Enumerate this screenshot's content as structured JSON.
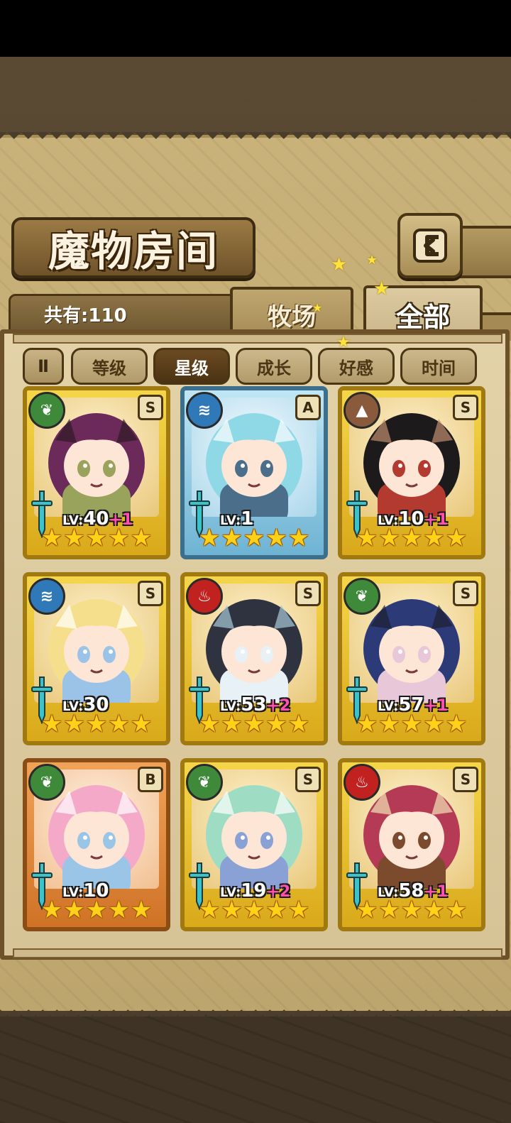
{
  "header": {
    "title": "魔物房间",
    "back_icon": "back-arrow-icon"
  },
  "tabs": {
    "count_label": "共有:110",
    "ranch_label": "牧场",
    "all_label": "全部"
  },
  "filters": {
    "pause_label": "Ⅱ",
    "items": [
      "等级",
      "星级",
      "成长",
      "好感",
      "时间"
    ],
    "active": "星级"
  },
  "monsters": [
    {
      "element": "grass",
      "rank": "S",
      "level": "40",
      "plus": "+1",
      "stars": 5,
      "palette": [
        "#6b2a5a",
        "#2d1a24",
        "#9aa35c"
      ]
    },
    {
      "element": "water",
      "rank": "A",
      "level": "1",
      "plus": "",
      "stars": 5,
      "palette": [
        "#8fd8e6",
        "#ffffff",
        "#4b6f8a"
      ]
    },
    {
      "element": "earth",
      "rank": "S",
      "level": "10",
      "plus": "+1",
      "stars": 5,
      "palette": [
        "#1d1a1c",
        "#c08f6e",
        "#b33a2f"
      ]
    },
    {
      "element": "water",
      "rank": "S",
      "level": "30",
      "plus": "",
      "stars": 5,
      "palette": [
        "#f6df8c",
        "#ffffff",
        "#9bc3e8"
      ]
    },
    {
      "element": "fire",
      "rank": "S",
      "level": "53",
      "plus": "+2",
      "stars": 5,
      "palette": [
        "#2f3340",
        "#a8c7d6",
        "#e7f1f6"
      ]
    },
    {
      "element": "grass",
      "rank": "S",
      "level": "57",
      "plus": "+1",
      "stars": 5,
      "palette": [
        "#2c3a78",
        "#1f1f30",
        "#e7c7d8"
      ]
    },
    {
      "element": "grass",
      "rank": "B",
      "level": "10",
      "plus": "",
      "stars": 5,
      "palette": [
        "#f4a9c8",
        "#ffffff",
        "#9bc5e6"
      ]
    },
    {
      "element": "grass",
      "rank": "S",
      "level": "19",
      "plus": "+2",
      "stars": 5,
      "palette": [
        "#9fdcc4",
        "#ffffff",
        "#8aa1d6"
      ]
    },
    {
      "element": "fire",
      "rank": "S",
      "level": "58",
      "plus": "+1",
      "stars": 5,
      "palette": [
        "#b53a56",
        "#f4e3b6",
        "#7c4a2c"
      ]
    }
  ],
  "level_prefix": "LV:",
  "element_icons": {
    "grass": "leaf-icon",
    "water": "water-waves-icon",
    "earth": "mountain-icon",
    "fire": "flame-icon"
  }
}
